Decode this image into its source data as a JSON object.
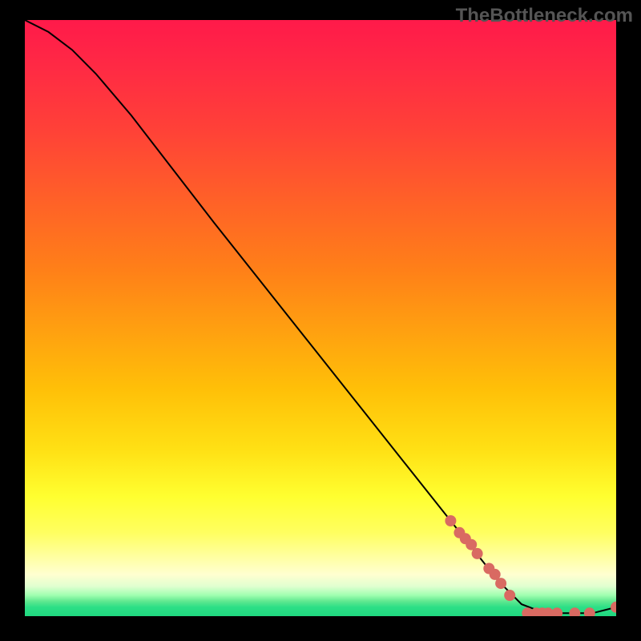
{
  "watermark": "TheBottleneck.com",
  "chart_data": {
    "type": "line",
    "title": "",
    "xlabel": "",
    "ylabel": "",
    "xlim": [
      0,
      100
    ],
    "ylim": [
      0,
      100
    ],
    "curve": {
      "x": [
        0,
        4,
        8,
        12,
        18,
        25,
        32,
        40,
        48,
        56,
        64,
        72,
        80,
        84,
        88,
        92,
        96,
        100
      ],
      "y": [
        100,
        98,
        95,
        91,
        84,
        75,
        66,
        56,
        46,
        36,
        26,
        16,
        6,
        2,
        0.5,
        0.5,
        0.5,
        1.5
      ]
    },
    "markers": {
      "x": [
        72,
        73.5,
        74.5,
        75.5,
        76.5,
        78.5,
        79.5,
        80.5,
        82,
        85,
        86.5,
        87.5,
        88.5,
        90,
        93,
        95.5,
        100
      ],
      "y": [
        16,
        14,
        13,
        12,
        10.5,
        8,
        7,
        5.5,
        3.5,
        0.5,
        0.5,
        0.5,
        0.5,
        0.5,
        0.5,
        0.5,
        1.5
      ]
    }
  }
}
